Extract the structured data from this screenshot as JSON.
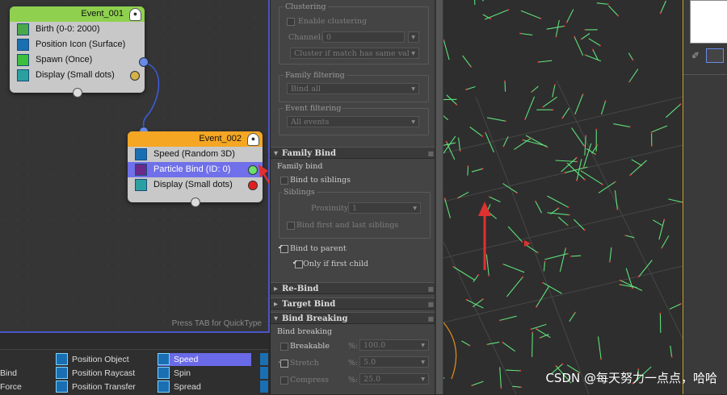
{
  "graph": {
    "event1": {
      "title": "Event_001",
      "ops": [
        "Birth (0-0: 2000)",
        "Position Icon (Surface)",
        "Spawn (Once)",
        "Display (Small dots)"
      ]
    },
    "event2": {
      "title": "Event_002",
      "ops": [
        "Speed (Random 3D)",
        "Particle Bind (ID: 0)",
        "Display (Small dots)"
      ]
    },
    "hint": "Press TAB for QuickType",
    "bulb_icon": "lightbulb-icon"
  },
  "depot": {
    "items": [
      {
        "label": "Bind"
      },
      {
        "label": "Force"
      },
      {
        "label": "Position Object"
      },
      {
        "label": "Position Raycast"
      },
      {
        "label": "Position Transfer"
      },
      {
        "label": "Speed"
      },
      {
        "label": "Spin"
      },
      {
        "label": "Spread"
      }
    ]
  },
  "panel": {
    "clustering": {
      "title": "Clustering",
      "enable": "Enable clustering",
      "channel_label": "Channel:",
      "channel_value": "0",
      "cluster_dd": "Cluster if match has same val"
    },
    "family_filtering": {
      "title": "Family filtering",
      "value": "Bind all"
    },
    "event_filtering": {
      "title": "Event filtering",
      "value": "All events"
    },
    "family_bind_rollout": "Family Bind",
    "family_bind_label": "Family bind",
    "bind_siblings": "Bind to siblings",
    "siblings": {
      "title": "Siblings",
      "proximity_label": "Proximity",
      "proximity_value": "1",
      "first_last": "Bind first and last siblings"
    },
    "bind_parent": "Bind to parent",
    "only_first": "Only if first child",
    "rebind_rollout": "Re-Bind",
    "target_rollout": "Target Bind",
    "breaking_rollout": "Bind Breaking",
    "breaking_label": "Bind breaking",
    "breakable": "Breakable",
    "breakable_pct": "%:",
    "breakable_val": "100.0",
    "stretch": "Stretch",
    "stretch_pct": "%:",
    "stretch_val": "5.0",
    "compress": "Compress",
    "compress_pct": "%:",
    "compress_val": "25.0"
  },
  "watermark": "CSDN @每天努力一点点，哈哈",
  "colors": {
    "event1_head": "#8fd14f",
    "event2_head": "#f5a623",
    "selection": "#7070ea",
    "wire": "#3b5bd9",
    "arrow": "#e03030",
    "particle": "#5fe07a"
  }
}
